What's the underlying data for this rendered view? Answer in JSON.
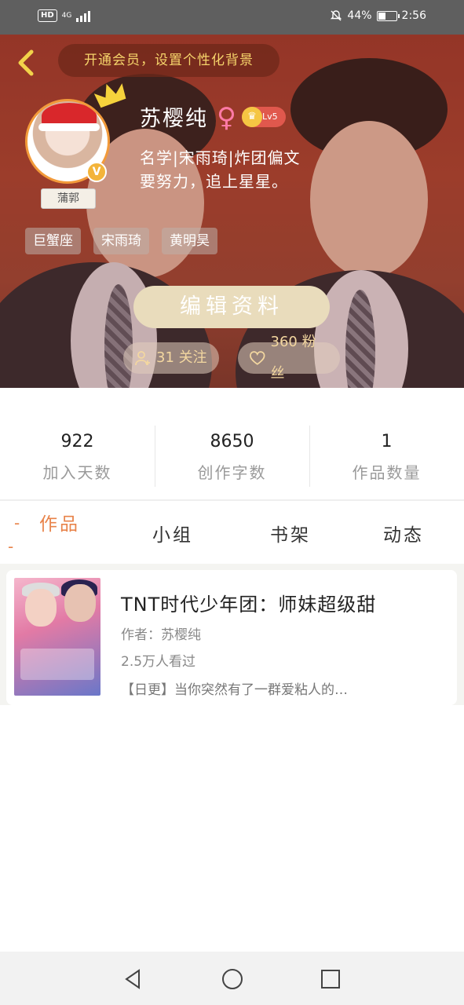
{
  "status_bar": {
    "hd": "HD",
    "network": "4G",
    "battery": "44%",
    "battery_level": 0.44,
    "time": "2:56"
  },
  "header": {
    "vip_prompt": "开通会员，设置个性化背景",
    "avatar_tag": "蒲郭",
    "username": "苏樱纯",
    "gender_symbol": "♀",
    "level": "Lv5",
    "v_badge": "V",
    "bio_line1": "名学|宋雨琦|炸团偏文",
    "bio_line2": "要努力，追上星星。",
    "tags": [
      "巨蟹座",
      "宋雨琦",
      "黄明昊"
    ],
    "edit_button": "编辑资料",
    "following": "31 关注",
    "fans": "360 粉丝"
  },
  "stats": [
    {
      "value": "922",
      "label": "加入天数"
    },
    {
      "value": "8650",
      "label": "创作字数"
    },
    {
      "value": "1",
      "label": "作品数量"
    }
  ],
  "tabs": [
    "作品",
    "小组",
    "书架",
    "动态"
  ],
  "works": [
    {
      "title": "TNT时代少年团：师妹超级甜",
      "author": "作者：苏樱纯",
      "views": "2.5万人看过",
      "description": "【日更】当你突然有了一群爱粘人的…"
    }
  ],
  "colors": {
    "accent": "#e8834a",
    "banner": "#a8442f",
    "edit_button": "#e9dcbc",
    "vip_text": "#f6d46b"
  }
}
